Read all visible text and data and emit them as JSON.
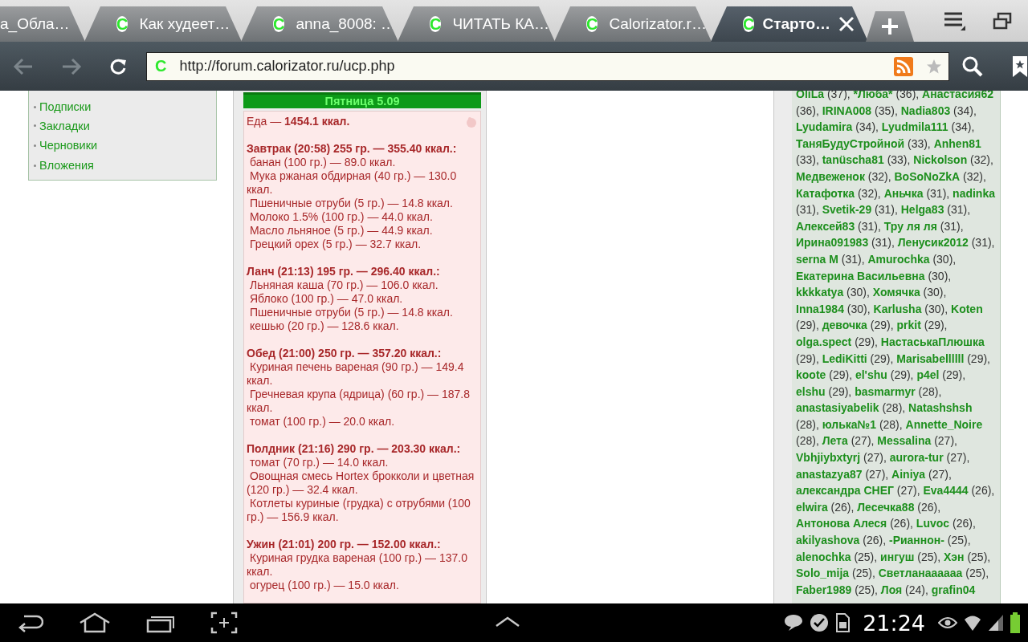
{
  "tabs": [
    {
      "title": "а_Обла…",
      "selected": false
    },
    {
      "title": "Как худеет…",
      "favicon": "C",
      "selected": false
    },
    {
      "title": "anna_8008: …",
      "favicon": "C",
      "selected": false
    },
    {
      "title": "ЧИТАТЬ КА…",
      "favicon": "C",
      "selected": false
    },
    {
      "title": "Calorizator.r…",
      "favicon": "C",
      "selected": false
    },
    {
      "title": "Старто…",
      "favicon": "C",
      "selected": true
    }
  ],
  "address_bar": {
    "favicon": "C",
    "url": "http://forum.calorizator.ru/ucp.php"
  },
  "left_menu": {
    "items": [
      "Подписки",
      "Закладки",
      "Черновики",
      "Вложения"
    ]
  },
  "diary": {
    "day": "Пятница 5.09",
    "total_label": "Еда —",
    "total_value": "1454.1 ккал.",
    "meals": [
      {
        "title": "Завтрак (20:58) 255 гр. — 355.40 ккал.:",
        "items": [
          "банан (100 гр.) — 89.0 ккал.",
          "Мука ржаная обдирная (40 гр.) — 130.0 ккал.",
          "Пшеничные отруби (5 гр.) — 14.8 ккал.",
          "Молоко 1.5% (100 гр.) — 44.0 ккал.",
          "Масло льняное (5 гр.) — 44.9 ккал.",
          "Грецкий орех (5 гр.) — 32.7 ккал."
        ]
      },
      {
        "title": "Ланч (21:13) 195 гр. — 296.40 ккал.:",
        "items": [
          "Льняная каша (70 гр.) — 106.0 ккал.",
          "Яблоко (100 гр.) — 47.0 ккал.",
          "Пшеничные отруби (5 гр.) — 14.8 ккал.",
          "кешью (20 гр.) — 128.6 ккал."
        ]
      },
      {
        "title": "Обед (21:00) 250 гр. — 357.20 ккал.:",
        "items": [
          "Куриная печень вареная (90 гр.) — 149.4 ккал.",
          "Гречневая крупа (ядрица) (60 гр.) — 187.8 ккал.",
          "томат (100 гр.) — 20.0 ккал."
        ]
      },
      {
        "title": "Полдник (21:16) 290 гр. — 203.30 ккал.:",
        "items": [
          "томат (70 гр.) — 14.0 ккал.",
          "Овощная смесь Hortex брокколи и цветная (120 гр.) — 32.4 ккал.",
          "Котлеты куриные (грудка) с отрубями (100 гр.) — 156.9 ккал."
        ]
      },
      {
        "title": "Ужин (21:01) 200 гр. — 152.00 ккал.:",
        "items": [
          "Куриная грудка вареная (100 гр.) — 137.0 ккал.",
          "огурец (100 гр.) — 15.0 ккал."
        ]
      }
    ]
  },
  "users": [
    {
      "name": "OliLa",
      "count": "(37),"
    },
    {
      "name": "*Люба*",
      "count": "(36),"
    },
    {
      "name": "Анастасия62",
      "count": "(36),"
    },
    {
      "name": "IRINA008",
      "count": "(35),"
    },
    {
      "name": "Nadia803",
      "count": "(34),"
    },
    {
      "name": "Lyudamira",
      "count": "(34),"
    },
    {
      "name": "Lyudmila111",
      "count": "(34),"
    },
    {
      "name": "ТаняБудуСтройной",
      "count": "(33),"
    },
    {
      "name": "Anhen81",
      "count": "(33),"
    },
    {
      "name": "tanüscha81",
      "count": "(33),"
    },
    {
      "name": "Nickolson",
      "count": "(32),"
    },
    {
      "name": "Медвеженок",
      "count": "(32),"
    },
    {
      "name": "BoSoNoZkA",
      "count": "(32),"
    },
    {
      "name": "Катафотка",
      "count": "(32),"
    },
    {
      "name": "Аньчка",
      "count": "(31),"
    },
    {
      "name": "nadinka",
      "count": "(31),"
    },
    {
      "name": "Svetik-29",
      "count": "(31),"
    },
    {
      "name": "Helga83",
      "count": "(31),"
    },
    {
      "name": "Алексей83",
      "count": "(31),"
    },
    {
      "name": "Тру ля ля",
      "count": "(31),"
    },
    {
      "name": "Ирина091983",
      "count": "(31),"
    },
    {
      "name": "Ленусик2012",
      "count": "(31),"
    },
    {
      "name": "serna M",
      "count": "(31),"
    },
    {
      "name": "Amurochka",
      "count": "(30),"
    },
    {
      "name": "Екатерина Васильевна",
      "count": "(30),"
    },
    {
      "name": "kkkkatya",
      "count": "(30),"
    },
    {
      "name": "Хомячка",
      "count": "(30),"
    },
    {
      "name": "Inna1984",
      "count": "(30),"
    },
    {
      "name": "Karlusha",
      "count": "(30),"
    },
    {
      "name": "Koten",
      "count": "(29),"
    },
    {
      "name": "девочка",
      "count": "(29),"
    },
    {
      "name": "prkit",
      "count": "(29),"
    },
    {
      "name": "olga.spect",
      "count": "(29),"
    },
    {
      "name": "НастаськаПлюшка",
      "count": "(29),"
    },
    {
      "name": "LediKitti",
      "count": "(29),"
    },
    {
      "name": "Marisabellllll",
      "count": "(29),"
    },
    {
      "name": "koote",
      "count": "(29),"
    },
    {
      "name": "el'shu",
      "count": "(29),"
    },
    {
      "name": "p4el",
      "count": "(29),"
    },
    {
      "name": "elshu",
      "count": "(29),"
    },
    {
      "name": "basmarmyr",
      "count": "(28),"
    },
    {
      "name": "anastasiyabelik",
      "count": "(28),"
    },
    {
      "name": "Natashshsh",
      "count": "(28),"
    },
    {
      "name": "юлька№1",
      "count": "(28),"
    },
    {
      "name": "Annette_Noire",
      "count": "(28),"
    },
    {
      "name": "Лета",
      "count": "(27),"
    },
    {
      "name": "Messalina",
      "count": "(27),"
    },
    {
      "name": "Vbhjiybxtyrj",
      "count": "(27),"
    },
    {
      "name": "aurora-tur",
      "count": "(27),"
    },
    {
      "name": "anastazya87",
      "count": "(27),"
    },
    {
      "name": "Ainiya",
      "count": "(27),"
    },
    {
      "name": "александра СНЕГ",
      "count": "(27),"
    },
    {
      "name": "Eva4444",
      "count": "(26),"
    },
    {
      "name": "elwira",
      "count": "(26),"
    },
    {
      "name": "Лесечка88",
      "count": "(26),"
    },
    {
      "name": "Антонова Алеся",
      "count": "(26),"
    },
    {
      "name": "Luvoc",
      "count": "(26),"
    },
    {
      "name": "akilyashova",
      "count": "(26),"
    },
    {
      "name": "-Рианнон-",
      "count": "(25),"
    },
    {
      "name": "alenochka",
      "count": "(25),"
    },
    {
      "name": "ингуш",
      "count": "(25),"
    },
    {
      "name": "Хэн",
      "count": "(25),"
    },
    {
      "name": "Solo_mija",
      "count": "(25),"
    },
    {
      "name": "Светланаааааа",
      "count": "(25),"
    },
    {
      "name": "Faber1989",
      "count": "(25),"
    },
    {
      "name": "Лоя",
      "count": "(24),"
    },
    {
      "name": "grafin04"
    }
  ],
  "status_bar": {
    "time": "21:24"
  }
}
